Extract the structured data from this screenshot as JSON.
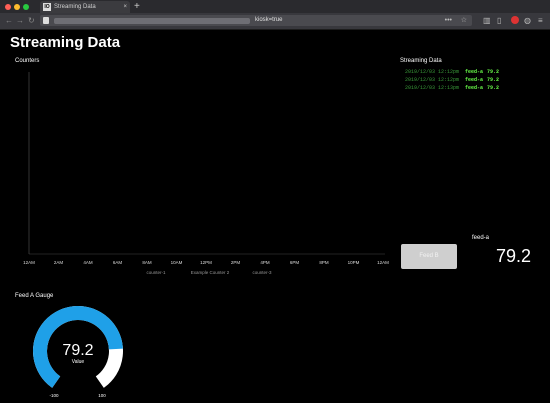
{
  "browser": {
    "tab_title": "Streaming Data",
    "favicon_text": "IO",
    "url_visible": "kiosk=true"
  },
  "dashboard": {
    "title": "Streaming Data",
    "counters": {
      "title": "Counters",
      "x_ticks": [
        "12AM",
        "2AM",
        "4AM",
        "6AM",
        "8AM",
        "10AM",
        "12PM",
        "2PM",
        "4PM",
        "6PM",
        "8PM",
        "10PM",
        "12AM"
      ],
      "legend": [
        "counter-1",
        "Example Counter 2",
        "counter-3"
      ]
    },
    "stream": {
      "title": "Streaming Data",
      "rows": [
        {
          "timestamp": "2019/12/03 12:12pm",
          "feed": "feed-a",
          "value": "79.2"
        },
        {
          "timestamp": "2019/12/03 12:12pm",
          "feed": "feed-a",
          "value": "79.2"
        },
        {
          "timestamp": "2019/12/03 12:13pm",
          "feed": "feed-a",
          "value": "79.2"
        }
      ]
    },
    "feed_button": {
      "label": "Feed B"
    },
    "feed_value": {
      "label": "feed-a",
      "value": "79.2"
    },
    "gauge": {
      "title": "Feed A Gauge",
      "value": "79.2",
      "value_label": "Value",
      "min": "-100",
      "max": "100",
      "fill_fraction": 0.8,
      "color_fill": "#1fa0e8",
      "color_track": "#ffffff"
    }
  }
}
